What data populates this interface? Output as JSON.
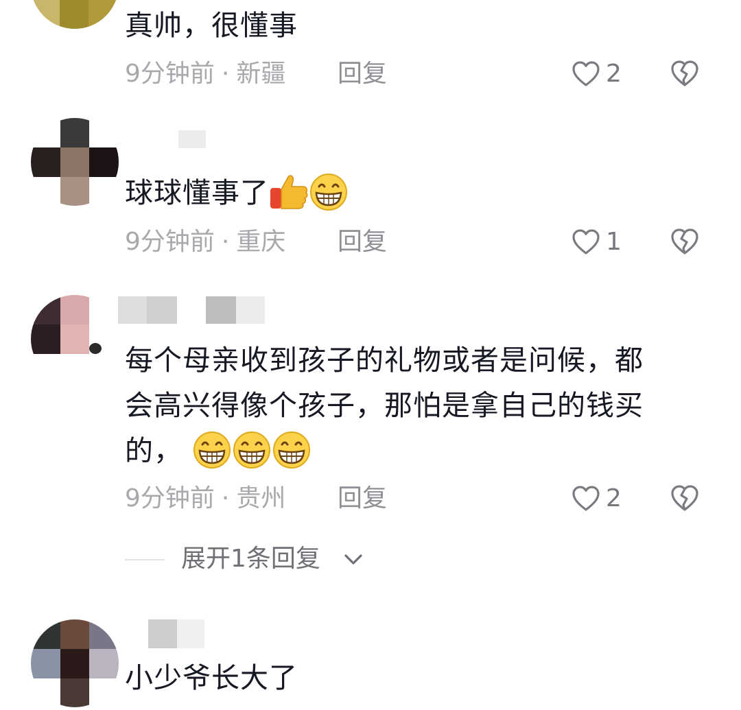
{
  "comments": [
    {
      "text": "真帅，很懂事",
      "time": "9分钟前",
      "location": "新疆",
      "reply_label": "回复",
      "like_count": "2"
    },
    {
      "text": "球球懂事了",
      "emojis": [
        "thumbs-up",
        "grin"
      ],
      "time": "9分钟前",
      "location": "重庆",
      "reply_label": "回复",
      "like_count": "1"
    },
    {
      "text_line1": "每个母亲收到孩子的礼物或者是问候，都",
      "text_line2": "会高兴得像个孩子，那怕是拿自己的钱买",
      "text_line3": "的，",
      "emojis": [
        "grin",
        "grin",
        "grin"
      ],
      "time": "9分钟前",
      "location": "贵州",
      "reply_label": "回复",
      "like_count": "2",
      "expand_label": "展开1条回复"
    },
    {
      "text": "小少爷长大了"
    }
  ],
  "meta_separator": "·",
  "colors": {
    "text": "#161823",
    "meta": "#a8a8ad",
    "like_icon": "#7a7a80",
    "background": "#ffffff"
  }
}
